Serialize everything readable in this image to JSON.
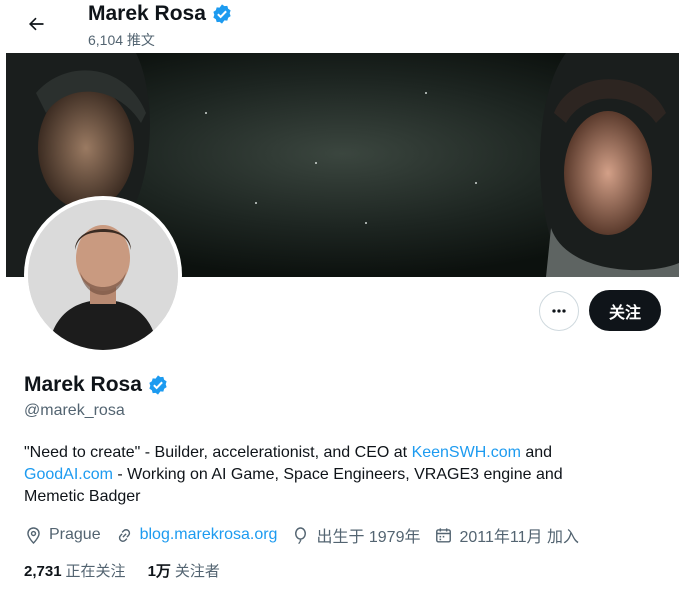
{
  "header": {
    "back_icon": "arrow-left-icon",
    "name": "Marek Rosa",
    "post_count": "6,104 推文"
  },
  "profile": {
    "name": "Marek Rosa",
    "verified_icon": "verified-badge-icon",
    "handle": "@marek_rosa",
    "more_icon": "more-dots-icon",
    "follow_label": "关注",
    "bio": {
      "part1": "\"Need to create\" - Builder, accelerationist, and CEO at ",
      "link1": "KeenSWH.com",
      "part2": " and ",
      "link2": "GoodAI.com",
      "part3": " - Working on AI Game, Space Engineers, VRAGE3 engine and Memetic Badger"
    },
    "meta": {
      "location": "Prague",
      "website": "blog.marekrosa.org",
      "birth": "出生于 1979年",
      "joined": "2011年11月 加入"
    },
    "stats": {
      "following_count": "2,731",
      "following_label": "正在关注",
      "followers_count": "1万",
      "followers_label": "关注者"
    }
  },
  "colors": {
    "accent": "#1d9bf0",
    "text": "#0f1419",
    "secondary": "#536471",
    "button_dark": "#0f1419"
  }
}
